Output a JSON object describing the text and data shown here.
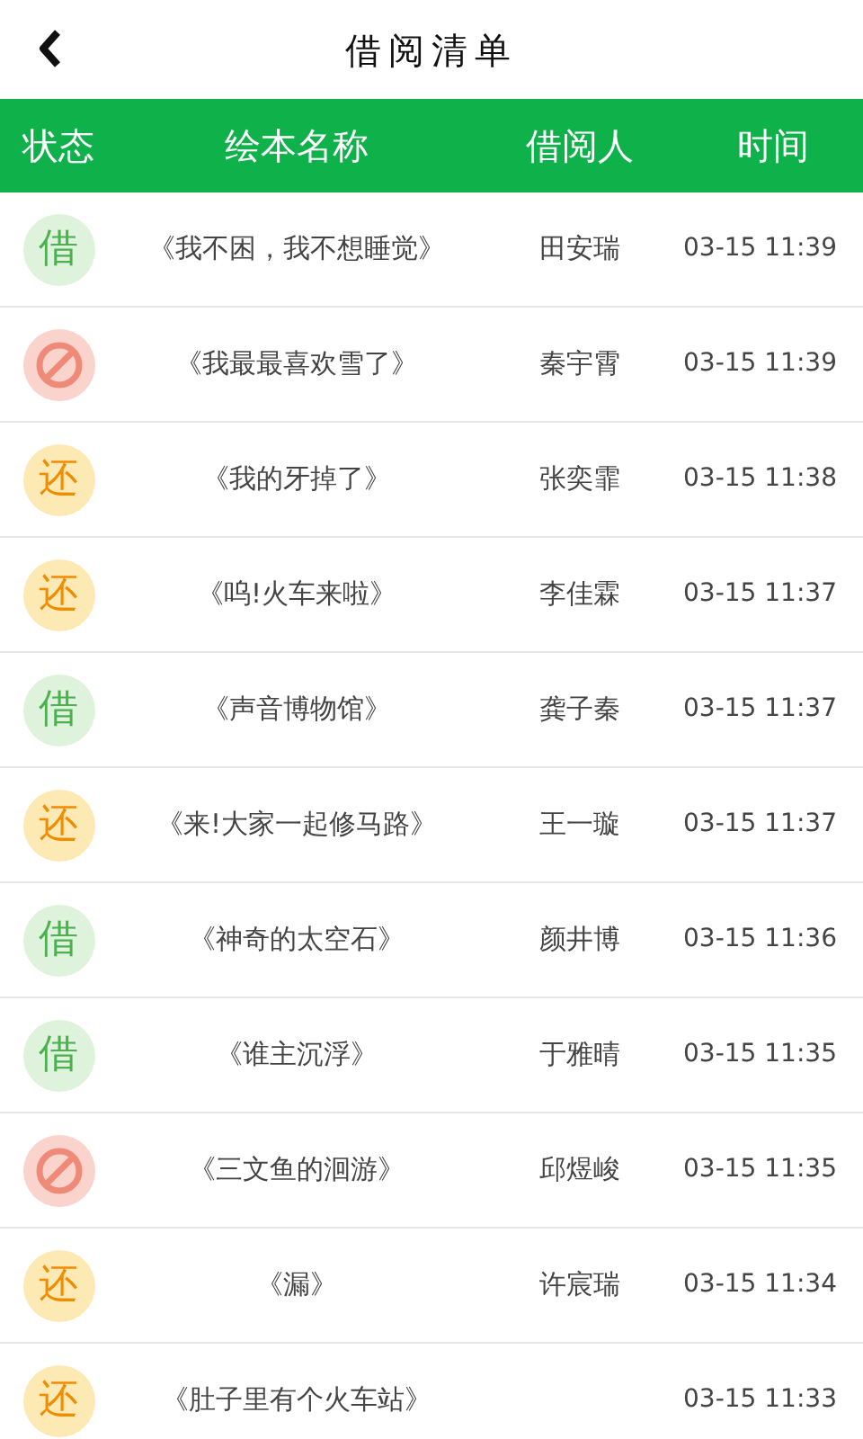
{
  "title": "借阅清单",
  "columns": [
    "状态",
    "绘本名称",
    "借阅人",
    "时间"
  ],
  "rows": [
    {
      "status": {
        "kind": "borrow",
        "label": "借"
      },
      "book": "《我不困，我不想睡觉》",
      "borrower": "田安瑞",
      "time": "03-15 11:39"
    },
    {
      "status": {
        "kind": "denied"
      },
      "book": "《我最最喜欢雪了》",
      "borrower": "秦宇霄",
      "time": "03-15 11:39"
    },
    {
      "status": {
        "kind": "return",
        "label": "还"
      },
      "book": "《我的牙掉了》",
      "borrower": "张奕霏",
      "time": "03-15 11:38"
    },
    {
      "status": {
        "kind": "return",
        "label": "还"
      },
      "book": "《呜!火车来啦》",
      "borrower": "李佳霖",
      "time": "03-15 11:37"
    },
    {
      "status": {
        "kind": "borrow",
        "label": "借"
      },
      "book": "《声音博物馆》",
      "borrower": "龚子秦",
      "time": "03-15 11:37"
    },
    {
      "status": {
        "kind": "return",
        "label": "还"
      },
      "book": "《来!大家一起修马路》",
      "borrower": "王一璇",
      "time": "03-15 11:37"
    },
    {
      "status": {
        "kind": "borrow",
        "label": "借"
      },
      "book": "《神奇的太空石》",
      "borrower": "颜井博",
      "time": "03-15 11:36"
    },
    {
      "status": {
        "kind": "borrow",
        "label": "借"
      },
      "book": "《谁主沉浮》",
      "borrower": "于雅晴",
      "time": "03-15 11:35"
    },
    {
      "status": {
        "kind": "denied"
      },
      "book": "《三文鱼的洄游》",
      "borrower": "邱煜峻",
      "time": "03-15 11:35"
    },
    {
      "status": {
        "kind": "return",
        "label": "还"
      },
      "book": "《漏》",
      "borrower": "许宸瑞",
      "time": "03-15 11:34"
    },
    {
      "status": {
        "kind": "return",
        "label": "还"
      },
      "book": "《肚子里有个火车站》",
      "time": "03-15 11:33"
    }
  ]
}
